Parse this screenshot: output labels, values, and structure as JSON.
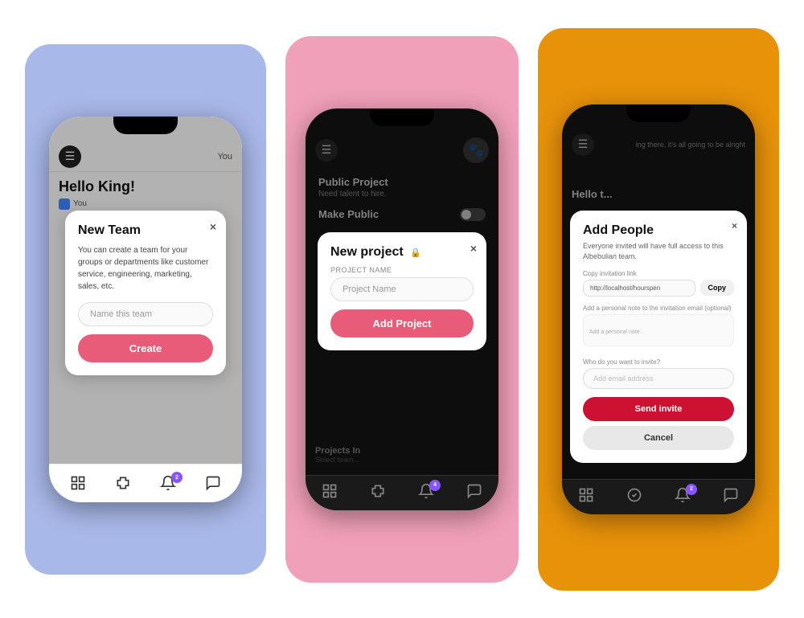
{
  "phone1": {
    "header": {
      "menuIcon": "☰",
      "headerRight": "You",
      "greeting": "Hello King!",
      "greetingSub": "You"
    },
    "modal": {
      "title": "New Team",
      "closeLabel": "×",
      "description": "You can create a team for your groups or departments like customer service, engineering, marketing, sales, etc.",
      "inputPlaceholder": "Name this team",
      "buttonLabel": "Create"
    },
    "bottomNav": {
      "icons": [
        "grid",
        "puzzle",
        "bell",
        "chat"
      ],
      "badgeCount": "2",
      "badgeIndex": 2
    }
  },
  "phone2": {
    "content": {
      "projectTitle": "Public Project",
      "projectSub": "Need talent to hire.",
      "toggleLabel": "Make Public"
    },
    "modal": {
      "title": "New project",
      "lockIcon": "🔒",
      "closeLabel": "×",
      "projectNameLabel": "Project Name",
      "projectNamePlaceholder": "Project Name",
      "buttonLabel": "Add Project"
    },
    "footer": {
      "projectsInLabel": "Projects In",
      "selectTeamLabel": "Select team..."
    },
    "bottomNav": {
      "badgeCount": "4",
      "badgeIndex": 2
    }
  },
  "phone3": {
    "headerText": "Hello t...",
    "headerSub": "ing there, it's all going to be alright",
    "modal": {
      "title": "Add People",
      "closeLabel": "×",
      "description": "Everyone invited will have full access to this Albebulian team.",
      "copyLinkLabel": "Copy invitation link",
      "linkValue": "http://localhost/hourspen",
      "copyButtonLabel": "Copy",
      "noteLabel": "Add a personal note to the invitation email (optional)",
      "notePlaceholder": "Add a personal note",
      "whoLabel": "Who do you want to invite?",
      "emailPlaceholder": "Add email address",
      "sendButtonLabel": "Send invite",
      "cancelButtonLabel": "Cancel"
    },
    "bottomNav": {
      "badgeCount": "2",
      "badgeIndex": 2
    }
  }
}
